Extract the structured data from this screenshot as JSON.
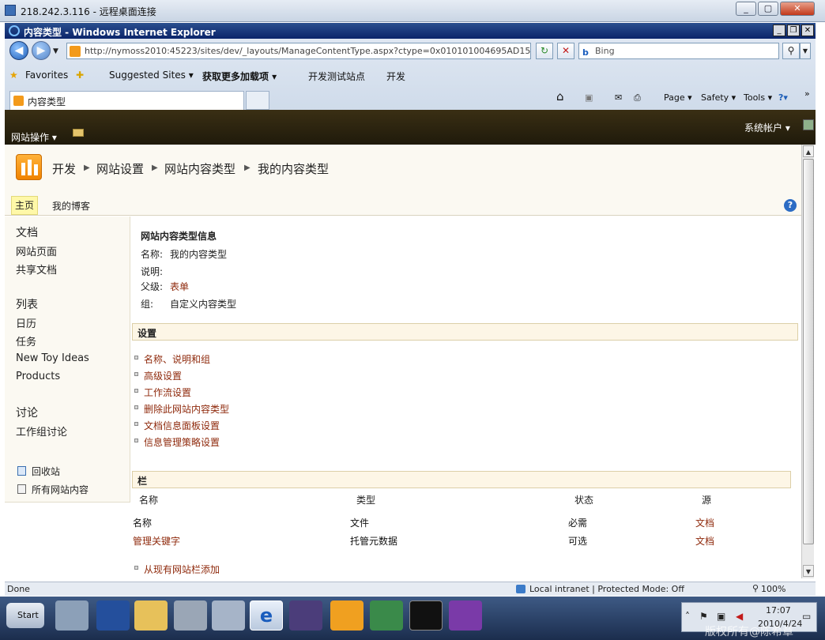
{
  "rdp_title": "218.242.3.116 - 远程桌面连接",
  "ie": {
    "title": "内容类型 - Windows Internet Explorer",
    "url": "http://nymoss2010:45223/sites/dev/_layouts/ManageContentType.aspx?ctype=0x010101004695AD15808CE24C",
    "search_placeholder": "Bing",
    "favorites": "Favorites",
    "fav_items": [
      "Suggested Sites ▾",
      "获取更多加载项 ▾",
      "开发测试站点",
      "开发"
    ],
    "tab_title": "内容类型",
    "cmds": [
      "Page ▾",
      "Safety ▾",
      "Tools ▾"
    ]
  },
  "sp": {
    "site_actions": "网站操作 ▾",
    "user": "系统帐户 ▾",
    "breadcrumb": [
      "开发",
      "网站设置",
      "网站内容类型",
      "我的内容类型"
    ],
    "topnav": [
      "主页",
      "我的博客"
    ],
    "leftnav": {
      "h1": "文档",
      "docs": [
        "网站页面",
        "共享文档"
      ],
      "h2": "列表",
      "lists": [
        "日历",
        "任务",
        "New Toy Ideas",
        "Products"
      ],
      "h3": "讨论",
      "disc": [
        "工作组讨论"
      ],
      "recycle": "回收站",
      "all": "所有网站内容"
    },
    "info": {
      "heading": "网站内容类型信息",
      "name_label": "名称:",
      "name": "我的内容类型",
      "desc_label": "说明:",
      "parent_label": "父级:",
      "parent": "表单",
      "group_label": "组:",
      "group": "自定义内容类型"
    },
    "settings_title": "设置",
    "settings_links": [
      "名称、说明和组",
      "高级设置",
      "工作流设置",
      "删除此网站内容类型",
      "文档信息面板设置",
      "信息管理策略设置"
    ],
    "columns_title": "栏",
    "col_headers": [
      "名称",
      "类型",
      "状态",
      "源"
    ],
    "rows": [
      [
        "名称",
        "文件",
        "必需",
        "文档"
      ],
      [
        "管理关键字",
        "托管元数据",
        "可选",
        "文档"
      ]
    ],
    "add_link": "从现有网站栏添加"
  },
  "status": {
    "left": "Done",
    "zone": "Local intranet | Protected Mode: Off",
    "zoom": "100%"
  },
  "taskbar": {
    "start": "Start",
    "time": "17:07",
    "date": "2010/4/24",
    "watermark": "版权所有@陈希章"
  }
}
